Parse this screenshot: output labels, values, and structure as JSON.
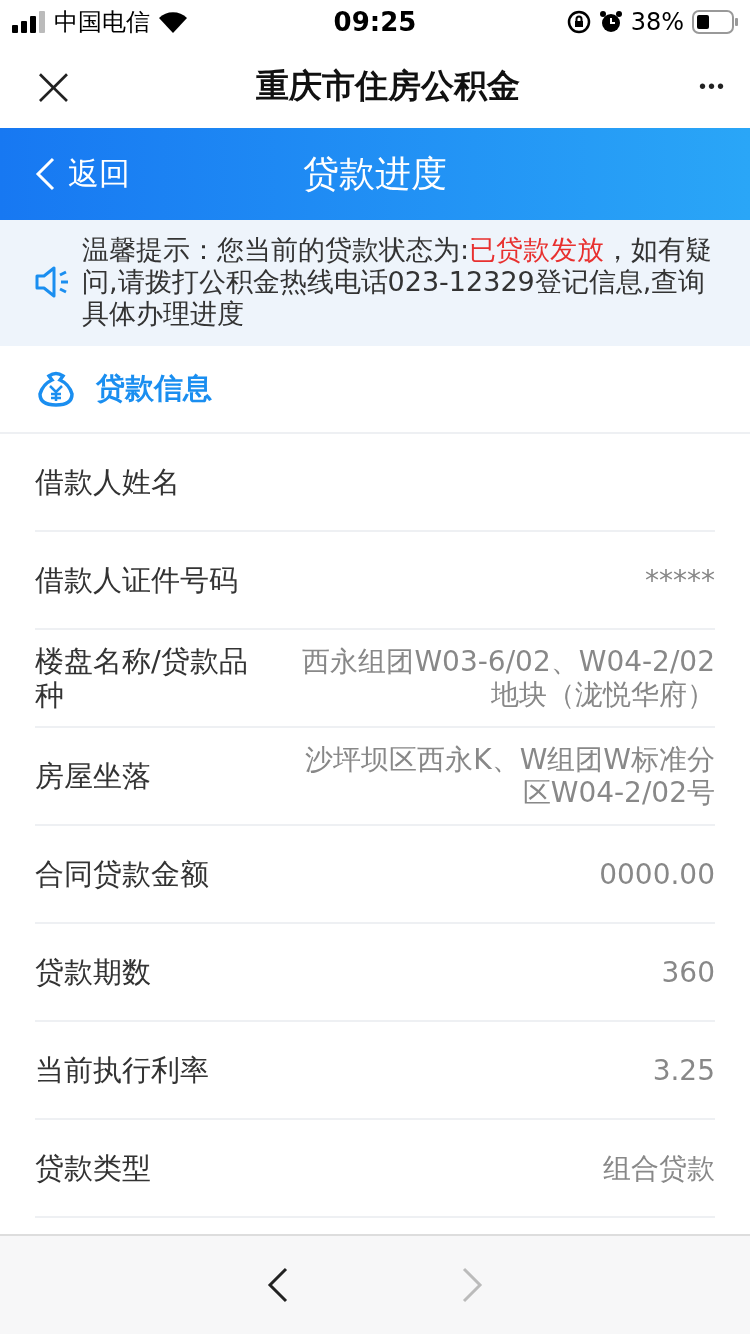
{
  "status_bar": {
    "carrier": "中国电信",
    "time": "09:25",
    "battery": "38%"
  },
  "nav_bar": {
    "close": "×",
    "title": "重庆市住房公积金",
    "more": "•••"
  },
  "header": {
    "back": "返回",
    "title": "贷款进度"
  },
  "notice": {
    "prefix": "温馨提示：您当前的贷款状态为:",
    "status": "已贷款发放",
    "suffix": "，如有疑问,请拨打公积金热线电话023-12329登记信息,查询具体办理进度"
  },
  "section": {
    "title": "贷款信息"
  },
  "rows": [
    {
      "label": "借款人姓名"
    },
    {
      "label": "借款人证件号码",
      "value": "*****"
    },
    {
      "label": "楼盘名称/贷款品种",
      "value": "西永组团W03-6/02、W04-2/02地块（泷悦华府）"
    },
    {
      "label": "房屋坐落",
      "value": "沙坪坝区西永K、W组团W标准分区W04-2/02号"
    },
    {
      "label": "合同贷款金额",
      "value": "0000.00"
    },
    {
      "label": "贷款期数",
      "value": "360"
    },
    {
      "label": "当前执行利率",
      "value": "3.25"
    },
    {
      "label": "贷款类型",
      "value": "组合贷款"
    }
  ],
  "browser_bar": {
    "back_disabled": false,
    "forward_disabled": true
  }
}
